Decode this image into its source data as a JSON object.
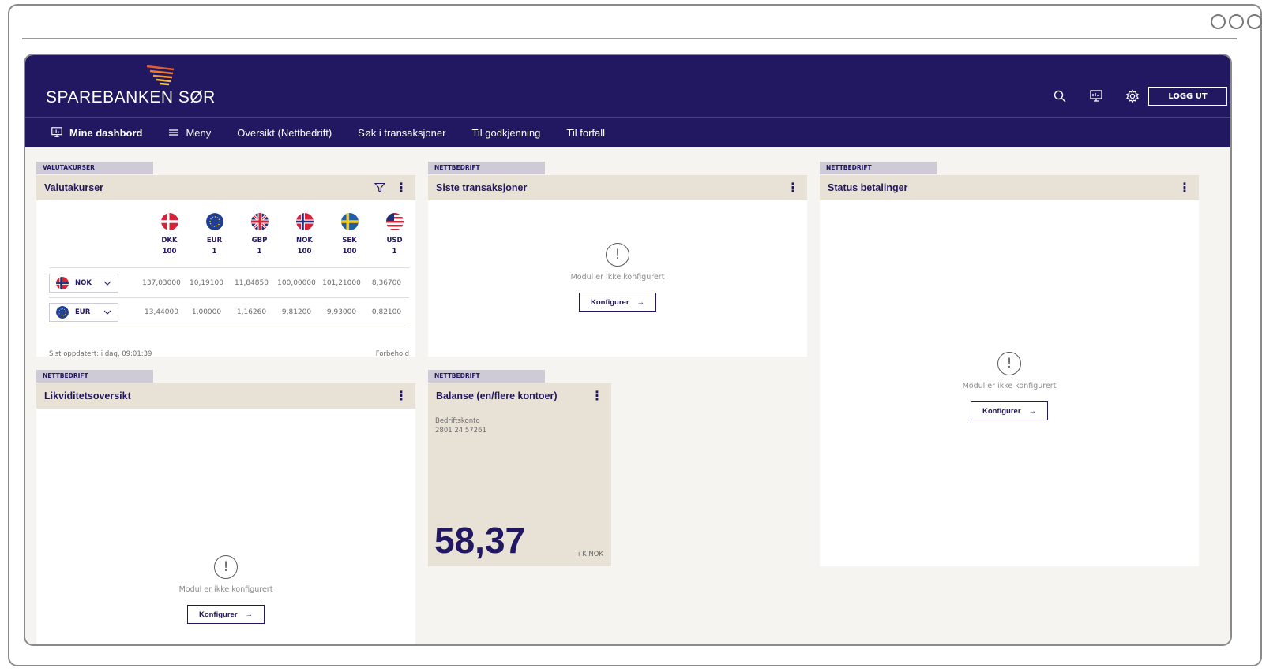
{
  "brand": {
    "name": "SPAREBANKEN SØR",
    "primary": "#221761",
    "beige": "#e8e2d6",
    "tag_bg": "#cfcbd6"
  },
  "header": {
    "icons": [
      "search-icon",
      "dashboard-icon",
      "gear-icon"
    ],
    "logout_label": "LOGG UT"
  },
  "nav": {
    "dashboard": "Mine dashbord",
    "menu": "Meny",
    "items": [
      "Oversikt (Nettbedrift)",
      "Søk i transaksjoner",
      "Til godkjenning",
      "Til forfall"
    ]
  },
  "currency": {
    "tag": "VALUTAKURSER",
    "title": "Valutakurser",
    "columns": [
      {
        "code": "DKK",
        "unit": "100"
      },
      {
        "code": "EUR",
        "unit": "1"
      },
      {
        "code": "GBP",
        "unit": "1"
      },
      {
        "code": "NOK",
        "unit": "100"
      },
      {
        "code": "SEK",
        "unit": "100"
      },
      {
        "code": "USD",
        "unit": "1"
      }
    ],
    "rows": [
      {
        "base": "NOK",
        "values": [
          "137,03000",
          "10,19100",
          "11,84850",
          "100,00000",
          "101,21000",
          "8,36700"
        ]
      },
      {
        "base": "EUR",
        "values": [
          "13,44000",
          "1,00000",
          "1,16260",
          "9,81200",
          "9,93000",
          "0,82100"
        ]
      }
    ],
    "updated": "Sist oppdatert: i dag, 09:01:39",
    "disclaimer": "Forbehold"
  },
  "transactions": {
    "tag": "NETTBEDRIFT",
    "title": "Siste transaksjoner"
  },
  "payments": {
    "tag": "NETTBEDRIFT",
    "title": "Status betalinger"
  },
  "liquidity": {
    "tag": "NETTBEDRIFT",
    "title": "Likviditetsoversikt"
  },
  "balance": {
    "tag": "NETTBEDRIFT",
    "title": "Balanse (en/flere kontoer)",
    "account_name": "Bedriftskonto",
    "account_number": "2801 24 57261",
    "value": "58,37",
    "unit": "i K NOK"
  },
  "empty": {
    "message": "Modul er ikke konfigurert",
    "button": "Konfigurer"
  }
}
